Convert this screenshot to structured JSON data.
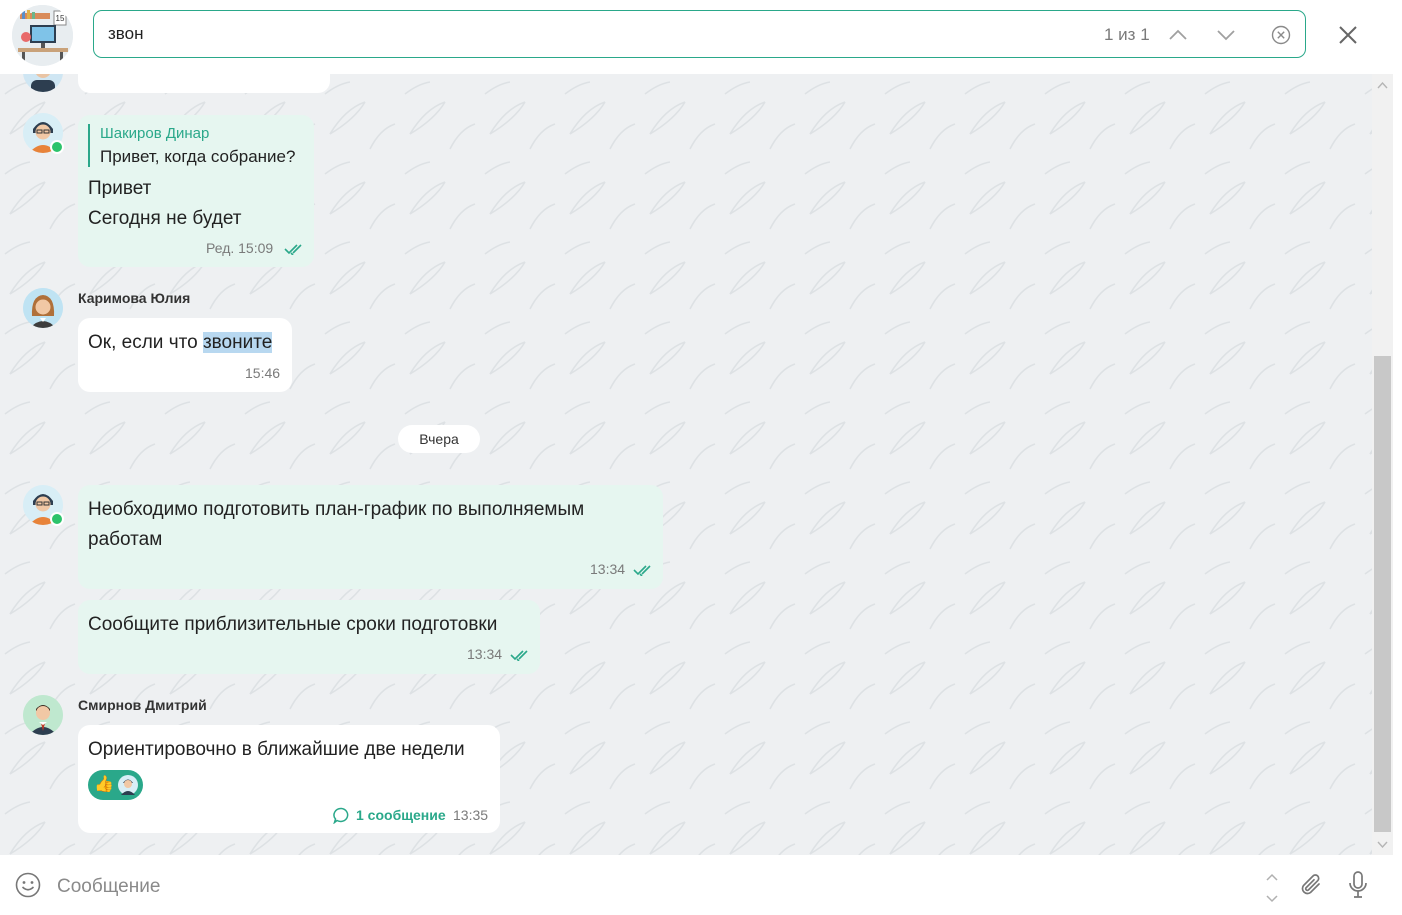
{
  "search": {
    "query": "звон",
    "count": "1 из 1"
  },
  "messages": [
    {
      "reply": {
        "name": "Шакиров Динар",
        "text": "Привет, когда собрание?"
      },
      "lines": [
        "Привет",
        "Сегодня не будет"
      ],
      "meta": "Ред. 15:09"
    },
    {
      "sender": "Каримова Юлия",
      "text_before": "Ок, если что ",
      "text_highlight": "звоните",
      "meta": "15:46"
    },
    {
      "lines": [
        "Необходимо подготовить план-график по выполняемым",
        "работам"
      ],
      "meta": "13:34"
    },
    {
      "lines": [
        "Сообщите приблизительные сроки подготовки"
      ],
      "meta": "13:34"
    },
    {
      "sender": "Смирнов Дмитрий",
      "lines": [
        "Ориентировочно в ближайшие две недели"
      ],
      "thread": "1 сообщение",
      "meta": "13:35"
    }
  ],
  "date_separator": "Вчера",
  "composer": {
    "placeholder": "Сообщение"
  },
  "colors": {
    "accent": "#2aa88a",
    "own_bubble": "#e6f6f0",
    "highlight": "#b8d8f0",
    "online": "#2cc36b"
  }
}
